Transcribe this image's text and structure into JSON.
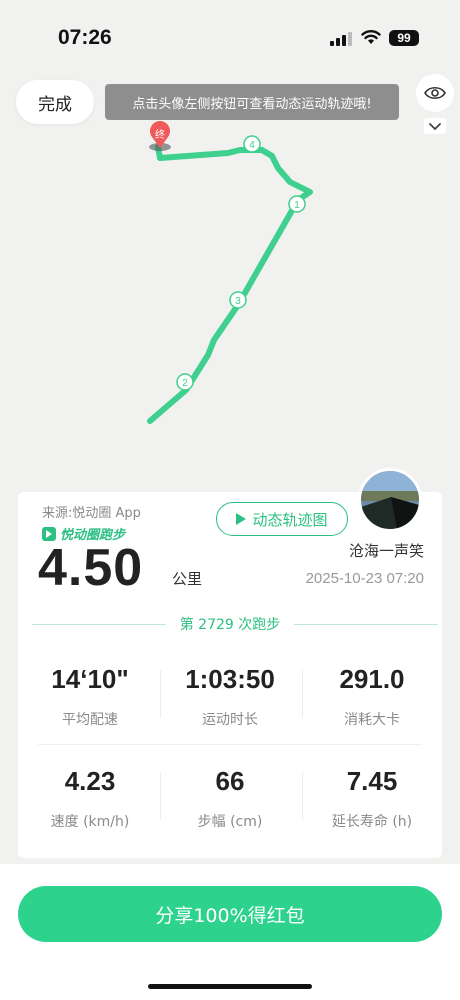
{
  "status_bar": {
    "time": "07:26",
    "battery": "99"
  },
  "map": {
    "done_label": "完成",
    "hint": "点击头像左侧按钮可查看动态运动轨迹哦!",
    "end_marker": "终",
    "km_markers": [
      "1",
      "2",
      "3",
      "4"
    ],
    "route_color": "#3fcf8e"
  },
  "card": {
    "source": "来源:悦动圈 App",
    "brand": "悦动圈跑步",
    "distance": "4.50",
    "unit": "公里",
    "dynamic_button": "动态轨迹图",
    "username": "沧海一声笑",
    "datetime": "2025-10-23 07:20",
    "run_count": "第 2729 次跑步",
    "stats": [
      {
        "value": "14‘10\"",
        "label": "平均配速"
      },
      {
        "value": "1:03:50",
        "label": "运动时长"
      },
      {
        "value": "291.0",
        "label": "消耗大卡"
      },
      {
        "value": "4.23",
        "label": "速度 (km/h)"
      },
      {
        "value": "66",
        "label": "步幅 (cm)"
      },
      {
        "value": "7.45",
        "label": "延长寿命 (h)"
      }
    ]
  },
  "share_button": "分享100%得红包",
  "colors": {
    "accent": "#2dd38d",
    "brand_green": "#2cc082"
  }
}
